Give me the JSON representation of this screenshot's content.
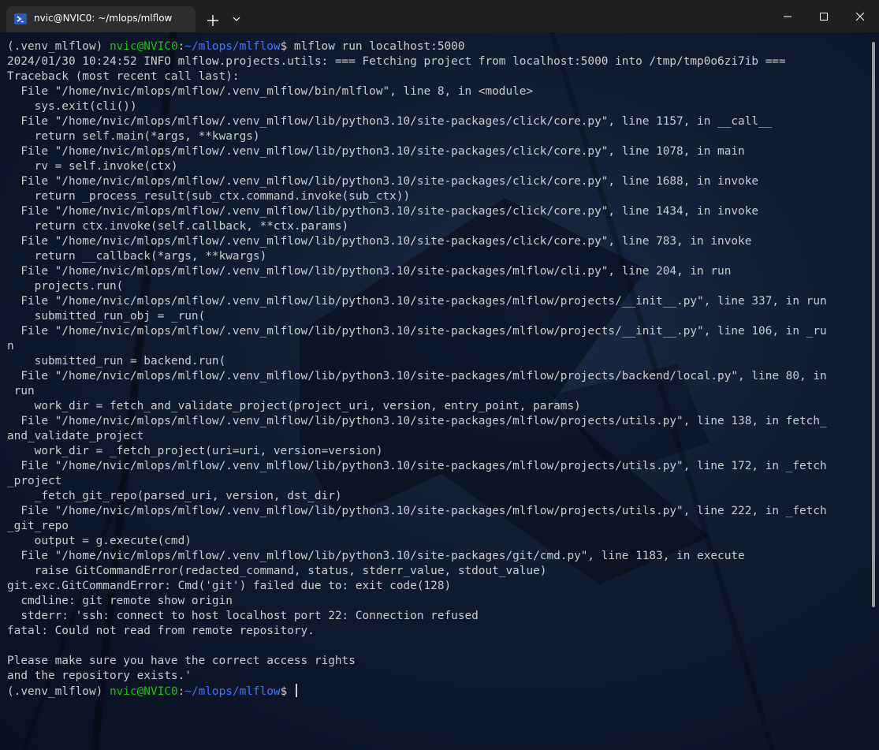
{
  "window": {
    "tab_title": "nvic@NVIC0: ~/mlops/mlflow",
    "tab_icon": "powershell-icon",
    "new_tab_icon": "plus-icon",
    "dropdown_icon": "chevron-down-icon",
    "controls": [
      "minimize-icon",
      "maximize-icon",
      "close-icon"
    ]
  },
  "colors": {
    "user_host": "#16c60c",
    "path": "#3b78ff",
    "text": "#cccccc",
    "titlebar": "#202020"
  },
  "prompt": {
    "venv": "(.venv_mlflow) ",
    "user_host": "nvic@NVIC0",
    "sep": ":",
    "path": "~/mlops/mlflow",
    "dollar": "$ ",
    "command": "mlflow run localhost:5000"
  },
  "output_lines": [
    "2024/01/30 10:24:52 INFO mlflow.projects.utils: === Fetching project from localhost:5000 into /tmp/tmp0o6zi7ib ===",
    "Traceback (most recent call last):",
    "  File \"/home/nvic/mlops/mlflow/.venv_mlflow/bin/mlflow\", line 8, in <module>",
    "    sys.exit(cli())",
    "  File \"/home/nvic/mlops/mlflow/.venv_mlflow/lib/python3.10/site-packages/click/core.py\", line 1157, in __call__",
    "    return self.main(*args, **kwargs)",
    "  File \"/home/nvic/mlops/mlflow/.venv_mlflow/lib/python3.10/site-packages/click/core.py\", line 1078, in main",
    "    rv = self.invoke(ctx)",
    "  File \"/home/nvic/mlops/mlflow/.venv_mlflow/lib/python3.10/site-packages/click/core.py\", line 1688, in invoke",
    "    return _process_result(sub_ctx.command.invoke(sub_ctx))",
    "  File \"/home/nvic/mlops/mlflow/.venv_mlflow/lib/python3.10/site-packages/click/core.py\", line 1434, in invoke",
    "    return ctx.invoke(self.callback, **ctx.params)",
    "  File \"/home/nvic/mlops/mlflow/.venv_mlflow/lib/python3.10/site-packages/click/core.py\", line 783, in invoke",
    "    return __callback(*args, **kwargs)",
    "  File \"/home/nvic/mlops/mlflow/.venv_mlflow/lib/python3.10/site-packages/mlflow/cli.py\", line 204, in run",
    "    projects.run(",
    "  File \"/home/nvic/mlops/mlflow/.venv_mlflow/lib/python3.10/site-packages/mlflow/projects/__init__.py\", line 337, in run",
    "    submitted_run_obj = _run(",
    "  File \"/home/nvic/mlops/mlflow/.venv_mlflow/lib/python3.10/site-packages/mlflow/projects/__init__.py\", line 106, in _ru",
    "n",
    "    submitted_run = backend.run(",
    "  File \"/home/nvic/mlops/mlflow/.venv_mlflow/lib/python3.10/site-packages/mlflow/projects/backend/local.py\", line 80, in",
    " run",
    "    work_dir = fetch_and_validate_project(project_uri, version, entry_point, params)",
    "  File \"/home/nvic/mlops/mlflow/.venv_mlflow/lib/python3.10/site-packages/mlflow/projects/utils.py\", line 138, in fetch_",
    "and_validate_project",
    "    work_dir = _fetch_project(uri=uri, version=version)",
    "  File \"/home/nvic/mlops/mlflow/.venv_mlflow/lib/python3.10/site-packages/mlflow/projects/utils.py\", line 172, in _fetch",
    "_project",
    "    _fetch_git_repo(parsed_uri, version, dst_dir)",
    "  File \"/home/nvic/mlops/mlflow/.venv_mlflow/lib/python3.10/site-packages/mlflow/projects/utils.py\", line 222, in _fetch",
    "_git_repo",
    "    output = g.execute(cmd)",
    "  File \"/home/nvic/mlops/mlflow/.venv_mlflow/lib/python3.10/site-packages/git/cmd.py\", line 1183, in execute",
    "    raise GitCommandError(redacted_command, status, stderr_value, stdout_value)",
    "git.exc.GitCommandError: Cmd('git') failed due to: exit code(128)",
    "  cmdline: git remote show origin",
    "  stderr: 'ssh: connect to host localhost port 22: Connection refused",
    "fatal: Could not read from remote repository.",
    "",
    "Please make sure you have the correct access rights",
    "and the repository exists.'"
  ]
}
